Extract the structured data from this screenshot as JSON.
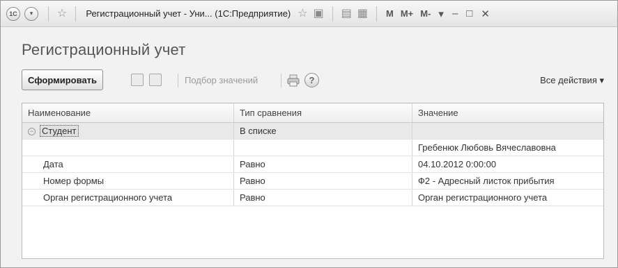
{
  "window": {
    "title": "Регистрационный учет - Уни... (1С:Предприятие)",
    "logo_text": "1С",
    "icons": [
      "back-icon",
      "favorites-star-icon",
      "star-icon",
      "bookmark-icon",
      "calculator-icon",
      "calendar-icon"
    ],
    "memory_buttons": [
      "M",
      "M+",
      "M-"
    ],
    "controls": {
      "dropdown": "▾",
      "minimize": "–",
      "maximize": "□",
      "close": "✕"
    }
  },
  "form": {
    "title": "Регистрационный учет"
  },
  "toolbar": {
    "generate_label": "Сформировать",
    "select_values_label": "Подбор значений",
    "help_label": "?",
    "all_actions_label": "Все действия ▾"
  },
  "table": {
    "columns": [
      "Наименование",
      "Тип сравнения",
      "Значение"
    ],
    "rows": [
      {
        "name": "Студент",
        "comparison": "В списке",
        "value": ""
      },
      {
        "name": "",
        "comparison": "",
        "value": "Гребенюк Любовь Вячеславовна"
      },
      {
        "name": "Дата",
        "comparison": "Равно",
        "value": "04.10.2012 0:00:00"
      },
      {
        "name": "Номер формы",
        "comparison": "Равно",
        "value": "Ф2 - Адресный листок прибытия"
      },
      {
        "name": "Орган регистрационного учета",
        "comparison": "Равно",
        "value": "Орган регистрационного учета"
      }
    ]
  },
  "colors": {
    "accent": "#555555",
    "group_row": "#e9e9e9",
    "border": "#b9b9b9"
  }
}
